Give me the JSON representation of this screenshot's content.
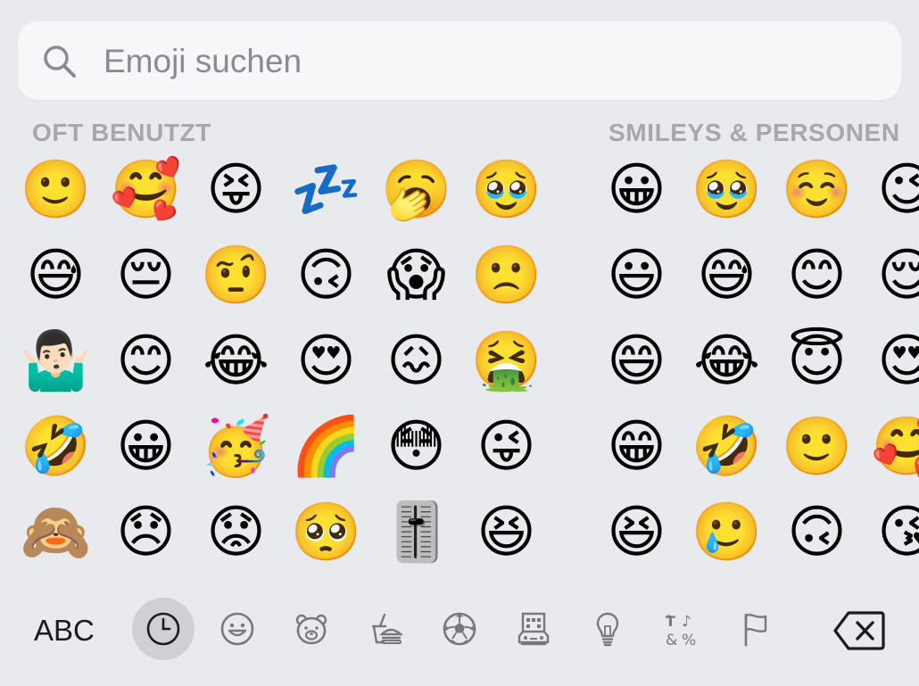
{
  "search": {
    "placeholder": "Emoji suchen"
  },
  "sections": [
    {
      "title": "OFT BENUTZT",
      "emojis": [
        "🙂",
        "😅",
        "🤷🏻‍♂️",
        "🤣",
        "🙈",
        "🥰",
        "😔",
        "😊",
        "😀",
        "😞",
        "😝",
        "🤨",
        "😂",
        "🥳",
        "😟",
        "💤",
        "🙃",
        "😍",
        "🌈",
        "🥺",
        "🥱",
        "😱",
        "😖",
        "😳",
        "🎚️",
        "🥹",
        "🙁",
        "🤮",
        "😜",
        "😆"
      ]
    },
    {
      "title": "SMILEYS & PERSONEN",
      "emojis": [
        "😀",
        "😃",
        "😄",
        "😁",
        "😆",
        "🥹",
        "😅",
        "😂",
        "🤣",
        "🥲",
        "☺️",
        "😊",
        "😇",
        "🙂",
        "🙃",
        "😉",
        "😌",
        "😍",
        "🥰",
        "😘"
      ]
    }
  ],
  "toolbar": {
    "abc_label": "ABC",
    "categories": [
      {
        "name": "clock-icon",
        "active": true
      },
      {
        "name": "smiley-icon",
        "active": false
      },
      {
        "name": "bear-icon",
        "active": false
      },
      {
        "name": "food-icon",
        "active": false
      },
      {
        "name": "soccer-ball-icon",
        "active": false
      },
      {
        "name": "building-car-icon",
        "active": false
      },
      {
        "name": "lightbulb-icon",
        "active": false
      },
      {
        "name": "symbols-icon",
        "active": false
      },
      {
        "name": "flag-icon",
        "active": false
      }
    ],
    "delete_icon": "delete-backspace-icon"
  },
  "colors": {
    "background": "#e9eaee",
    "search_background": "#f6f7f9",
    "section_title": "#a7a8ac",
    "active_category_background": "#cfd0d5",
    "icon_gray": "#77787d"
  }
}
